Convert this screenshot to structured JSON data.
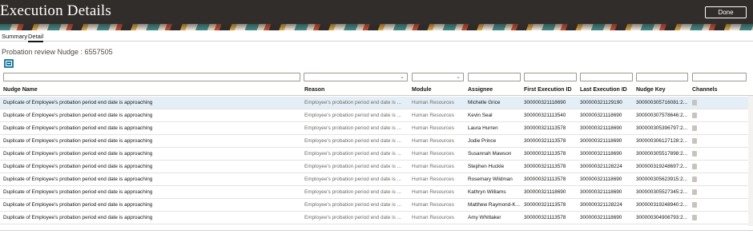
{
  "page": {
    "title": "Execution Details",
    "done_label": "Done"
  },
  "tabs": [
    {
      "label": "Summary",
      "active": false
    },
    {
      "label": "Detail",
      "active": true
    }
  ],
  "nudge_heading": "Probation review Nudge : 6557505",
  "export_icon": "export-icon",
  "columns": [
    "Nudge Name",
    "Reason",
    "Module",
    "Assignee",
    "First Execution ID",
    "Last Execution ID",
    "Nudge Key",
    "Channels"
  ],
  "filters": {
    "nudge_name": "",
    "reason": "",
    "module": "",
    "assignee": "",
    "first_execution_id": "",
    "last_execution_id": "",
    "nudge_key": "",
    "channels": ""
  },
  "rows": [
    {
      "nudge_name": "Duplicate of Employee's probation period end date is approaching",
      "reason": "Employee's probation period end date is ...",
      "module": "Human Resources",
      "assignee": "Michelle Grice",
      "first_id": "300000321118690",
      "last_id": "300000321129190",
      "nudge_key": "30000030571608​1:2...",
      "selected": true
    },
    {
      "nudge_name": "Duplicate of Employee's probation period end date is approaching",
      "reason": "Employee's probation period end date is ...",
      "module": "Human Resources",
      "assignee": "Kevin Seal",
      "first_id": "300000321113540",
      "last_id": "300000321118690",
      "nudge_key": "300000307578646:2...",
      "selected": false
    },
    {
      "nudge_name": "Duplicate of Employee's probation period end date is approaching",
      "reason": "Employee's probation period end date is ...",
      "module": "Human Resources",
      "assignee": "Laura Hurren",
      "first_id": "300000321113578",
      "last_id": "300000321118690",
      "nudge_key": "300000305396797:2...",
      "selected": false
    },
    {
      "nudge_name": "Duplicate of Employee's probation period end date is approaching",
      "reason": "Employee's probation period end date is ...",
      "module": "Human Resources",
      "assignee": "Jodie Prince",
      "first_id": "300000321113578",
      "last_id": "300000321118690",
      "nudge_key": "300000306127128:2...",
      "selected": false
    },
    {
      "nudge_name": "Duplicate of Employee's probation period end date is approaching",
      "reason": "Employee's probation period end date is ...",
      "module": "Human Resources",
      "assignee": "Susannah Mawson",
      "first_id": "300000321113578",
      "last_id": "300000321118690",
      "nudge_key": "300000305517898:2...",
      "selected": false
    },
    {
      "nudge_name": "Duplicate of Employee's probation period end date is approaching",
      "reason": "Employee's probation period end date is ...",
      "module": "Human Resources",
      "assignee": "Stephen Huckle",
      "first_id": "300000321113578",
      "last_id": "300000321128224",
      "nudge_key": "300000319248697:2...",
      "selected": false
    },
    {
      "nudge_name": "Duplicate of Employee's probation period end date is approaching",
      "reason": "Employee's probation period end date is ...",
      "module": "Human Resources",
      "assignee": "Rosemary Wildman",
      "first_id": "300000321113578",
      "last_id": "300000321118690",
      "nudge_key": "300000305623915:2...",
      "selected": false
    },
    {
      "nudge_name": "Duplicate of Employee's probation period end date is approaching",
      "reason": "Employee's probation period end date is ...",
      "module": "Human Resources",
      "assignee": "Kathryn Williams",
      "first_id": "300000321118690",
      "last_id": "300000321118690",
      "nudge_key": "300000305527345:2...",
      "selected": false
    },
    {
      "nudge_name": "Duplicate of Employee's probation period end date is approaching",
      "reason": "Employee's probation period end date is ...",
      "module": "Human Resources",
      "assignee": "Matthew Raymond-K...",
      "first_id": "300000321113578",
      "last_id": "300000321128224",
      "nudge_key": "300000319248940:2...",
      "selected": false
    },
    {
      "nudge_name": "Duplicate of Employee's probation period end date is approaching",
      "reason": "Employee's probation period end date is ...",
      "module": "Human Resources",
      "assignee": "Amy Whittaker",
      "first_id": "300000321113578",
      "last_id": "300000321118690",
      "nudge_key": "300000304906793:2...",
      "selected": false
    }
  ],
  "colors": {
    "header_bg": "#312d2a",
    "accent": "#227e9e",
    "selected_row": "#e4eef6"
  }
}
